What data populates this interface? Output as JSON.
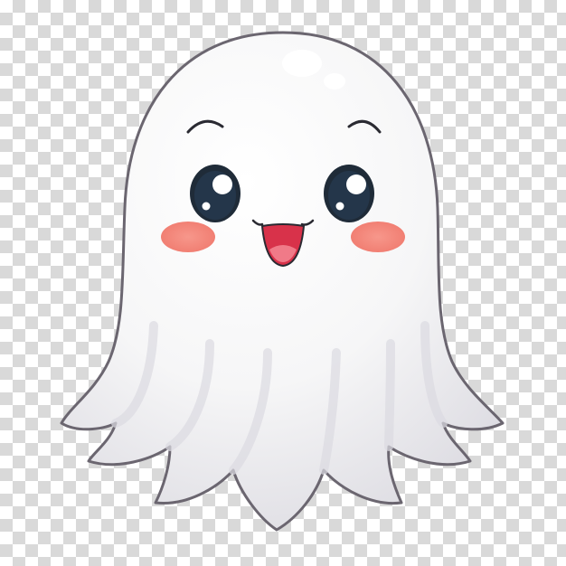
{
  "image": {
    "subject": "ghost-illustration",
    "background": "transparency-checkerboard"
  },
  "colors": {
    "checker_light": "#ffffff",
    "checker_dark": "#d9d9d9",
    "ghost_body": "#f7f7f7",
    "ghost_shade": "#e3e3e8",
    "ghost_outline": "#6b6670",
    "eye": "#1f2b38",
    "eye_highlight": "#ffffff",
    "cheek": "#f48a7e",
    "mouth": "#d8324a",
    "tongue": "#f07a88"
  }
}
